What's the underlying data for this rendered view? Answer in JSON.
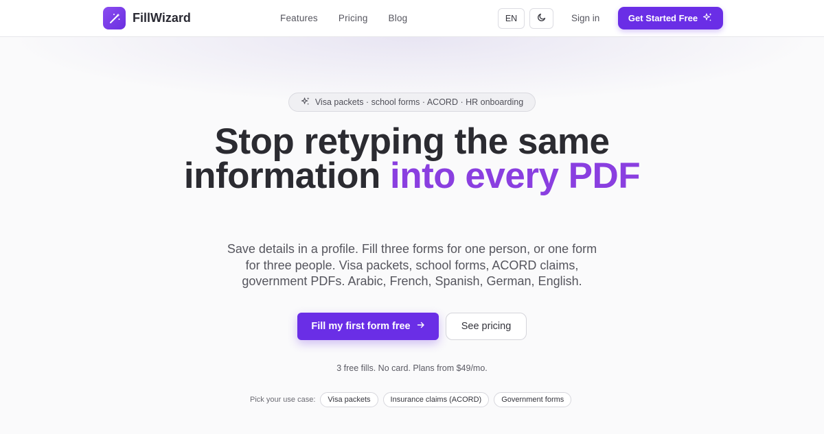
{
  "header": {
    "brand": "FillWizard",
    "nav": [
      "Features",
      "Pricing",
      "Blog"
    ],
    "language": "EN",
    "sign_in": "Sign in",
    "cta": "Get Started Free"
  },
  "hero": {
    "pill_text": "Visa packets · school forms · ACORD · HR onboarding",
    "headline_plain": "Stop retyping the same information ",
    "headline_accent": "into every PDF",
    "subtitle": "Save details in a profile. Fill three forms for one person, or one form for three people. Visa packets, school forms, ACORD claims, government PDFs. Arabic, French, Spanish, German, English.",
    "primary_button": "Fill my first form free",
    "secondary_button": "See pricing",
    "note": "3 free fills. No card. Plans from $49/mo.",
    "use_case_label": "Pick your use case:",
    "use_cases": [
      "Visa packets",
      "Insurance claims (ACORD)",
      "Government forms"
    ]
  },
  "colors": {
    "accent": "#6a2ee6",
    "headline_accent": "#8a3fe0",
    "background": "#fafafb"
  },
  "icons": [
    "magic-wand-icon",
    "moon-icon",
    "sparkles-icon",
    "arrow-right-icon"
  ]
}
